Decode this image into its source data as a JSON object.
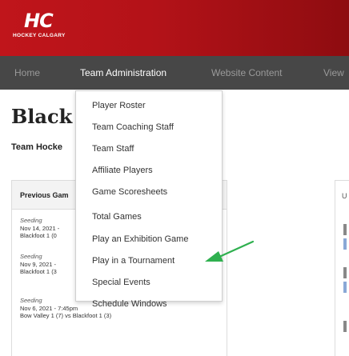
{
  "brand": {
    "logo_mark": "HC",
    "logo_text": "HOCKEY CALGARY"
  },
  "nav": {
    "items": [
      {
        "label": "Home"
      },
      {
        "label": "Team Administration"
      },
      {
        "label": "Website Content"
      },
      {
        "label": "View"
      }
    ],
    "active": "Team Administration"
  },
  "page": {
    "title": "Black",
    "subtitle": "Team Hocke"
  },
  "previous_games": {
    "header": "Previous Gam",
    "games": [
      {
        "stage": "Seeding",
        "date": "Nov 14, 2021 -",
        "score": "Blackfoot 1 (0"
      },
      {
        "stage": "Seeding",
        "date": "Nov 9, 2021 -",
        "score": "Blackfoot 1 (3"
      },
      {
        "stage": "Seeding",
        "date": "Nov 6, 2021 - 7:45pm",
        "score": "Bow Valley 1 (7) vs Blackfoot 1 (3)"
      }
    ]
  },
  "right_panel": {
    "header": "U"
  },
  "dropdown": {
    "items": [
      {
        "label": "Player Roster"
      },
      {
        "label": "Team Coaching Staff"
      },
      {
        "label": "Team Staff"
      },
      {
        "label": "Affiliate Players"
      },
      {
        "label": "Game Scoresheets"
      },
      {
        "label": "Total Games"
      },
      {
        "label": "Play an Exhibition Game"
      },
      {
        "label": "Play in a Tournament"
      },
      {
        "label": "Special Events"
      },
      {
        "label": "Schedule Windows"
      }
    ]
  },
  "annotation": {
    "arrow_color": "#2fb04f"
  },
  "colors": {
    "brand_red": "#c0151b",
    "nav_bg": "#474747",
    "link_blue": "#8aa8d6"
  }
}
